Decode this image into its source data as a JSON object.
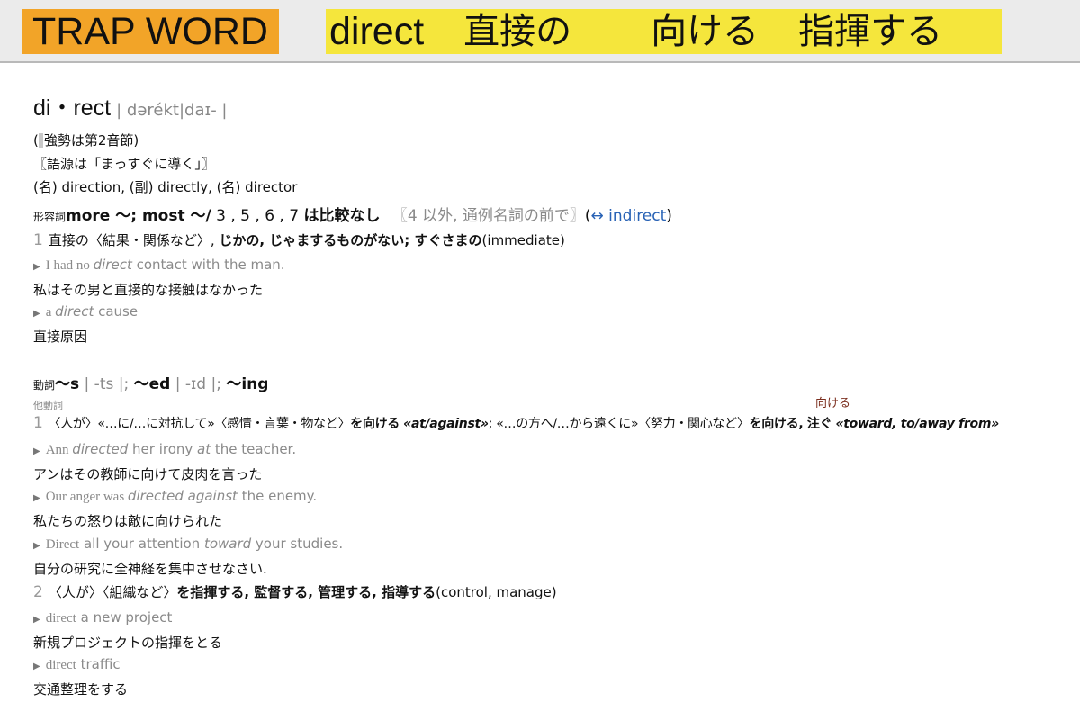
{
  "header": {
    "trap_label": "TRAP WORD",
    "word": "direct",
    "meaning_1": "直接の",
    "meaning_2": "向ける",
    "meaning_3": "指揮する"
  },
  "entry": {
    "headword": "di・rect",
    "pronunciation": "| dərékt|daɪ- |",
    "stress_note": "強勢は第2音節)",
    "etymology": "〖語源は「まっすぐに導く」〗",
    "derivatives": "(名) direction, (副) directly, (名) director",
    "adjective": {
      "pos": "形容詞",
      "forms": "more 〜; most 〜/",
      "not_comparable_senses": " 3 , 5 , 6 , 7 ",
      "not_comparable_label": "は比較なし",
      "usage_note": "〖4 以外, 通例名詞の前で〗",
      "antonym_open": "(",
      "antonym": "↔ indirect",
      "antonym_close": ")",
      "sense1_num": "1",
      "sense1_prefix": "直接の〈結果・関係など〉,",
      "sense1_bold": "じかの, じゃまするものがない; すぐさまの",
      "sense1_gloss": "(immediate)",
      "ex1_serif": "I had no ",
      "ex1_italic": "direct",
      "ex1_rest": " contact with the man.",
      "ex1_ja": "私はその男と直接的な接触はなかった",
      "ex2_serif": "a ",
      "ex2_italic": "direct",
      "ex2_rest": " cause",
      "ex2_ja": "直接原因"
    },
    "verb": {
      "pos": "動詞",
      "form_s": "〜s",
      "form_s_pron": "| -ts |;",
      "form_ed": "〜ed",
      "form_ed_pron": "| -ɪd |;",
      "form_ing": "〜ing",
      "transitive": "他動詞",
      "annotation": "向ける",
      "sense1_num": "1",
      "sense1_a": "〈人が〉«…に/…に対抗して»〈感情・言葉・物など〉",
      "sense1_b": "を向ける",
      "sense1_c": "«at/against»",
      "sense1_d": "; «…の方へ/…から遠くに»〈努力・関心など〉",
      "sense1_e": "を向ける, 注ぐ",
      "sense1_f": "«toward, to/away from»",
      "ex1_serif": "Ann ",
      "ex1_italic": "directed",
      "ex1_mid": " her irony ",
      "ex1_italic2": "at",
      "ex1_rest": " the teacher.",
      "ex1_ja": "アンはその教師に向けて皮肉を言った",
      "ex2_serif": "Our anger was ",
      "ex2_italic": "directed against",
      "ex2_rest": " the enemy.",
      "ex2_ja": "私たちの怒りは敵に向けられた",
      "ex3_serif": "Direct",
      "ex3_mid": " all your attention ",
      "ex3_italic": "toward",
      "ex3_rest": " your studies.",
      "ex3_ja": "自分の研究に全神経を集中させなさい.",
      "sense2_num": "2",
      "sense2_a": "〈人が〉〈組織など〉",
      "sense2_b": "を指揮する, 監督する, 管理する, 指導する",
      "sense2_gloss": "(control, manage)",
      "ex4_serif": "direct",
      "ex4_rest": " a new project",
      "ex4_ja": "新規プロジェクトの指揮をとる",
      "ex5_serif": "direct",
      "ex5_rest": " traffic",
      "ex5_ja": "交通整理をする"
    }
  },
  "icons": {
    "example_marker": "triangle-right-icon"
  },
  "colors": {
    "trap_label_bg": "#f2a428",
    "word_banner_bg": "#f5e63c",
    "link": "#2862b5",
    "annotation": "#7b2e1e"
  }
}
